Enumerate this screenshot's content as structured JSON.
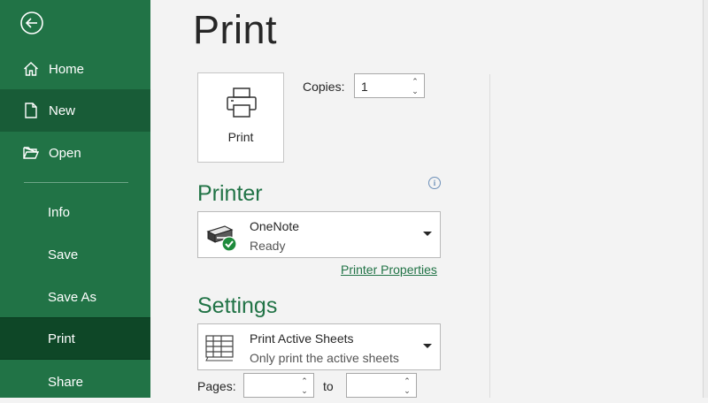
{
  "sidebar": {
    "nav_top": [
      {
        "label": "Home",
        "icon": "home-icon"
      },
      {
        "label": "New",
        "icon": "new-document-icon"
      },
      {
        "label": "Open",
        "icon": "open-folder-icon"
      }
    ],
    "nav_bottom": [
      "Info",
      "Save",
      "Save As",
      "Print",
      "Share"
    ],
    "selected": "Print",
    "colors": {
      "background": "#217346",
      "hover": "#185c37",
      "selected": "#0e4727"
    }
  },
  "main": {
    "title": "Print",
    "print_button": {
      "label": "Print",
      "icon": "printer-icon"
    },
    "copies": {
      "label": "Copies:",
      "value": "1"
    },
    "printer": {
      "heading": "Printer",
      "name": "OneNote",
      "status": "Ready",
      "properties_link": "Printer Properties",
      "info_icon": "info-icon"
    },
    "settings": {
      "heading": "Settings",
      "scope_main": "Print Active Sheets",
      "scope_sub": "Only print the active sheets",
      "pages_label": "Pages:",
      "to_label": "to",
      "pages_from": "",
      "pages_to": ""
    },
    "accent_color": "#217346"
  }
}
